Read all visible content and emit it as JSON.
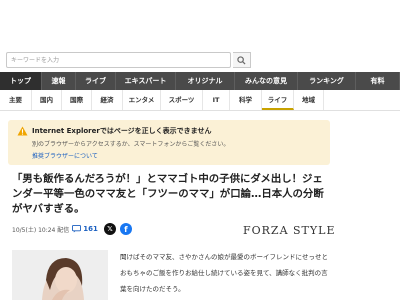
{
  "search": {
    "placeholder": "キーワードを入力"
  },
  "nav_primary": [
    {
      "label": "トップ",
      "active": true
    },
    {
      "label": "速報",
      "active": false
    },
    {
      "label": "ライブ",
      "active": false
    },
    {
      "label": "エキスパート",
      "active": false
    },
    {
      "label": "オリジナル",
      "active": false
    },
    {
      "label": "みんなの意見",
      "active": false
    },
    {
      "label": "ランキング",
      "active": false
    },
    {
      "label": "有料",
      "active": false
    }
  ],
  "nav_secondary": [
    {
      "label": "主要",
      "active": false
    },
    {
      "label": "国内",
      "active": false
    },
    {
      "label": "国際",
      "active": false
    },
    {
      "label": "経済",
      "active": false
    },
    {
      "label": "エンタメ",
      "active": false
    },
    {
      "label": "スポーツ",
      "active": false
    },
    {
      "label": "IT",
      "active": false
    },
    {
      "label": "科学",
      "active": false
    },
    {
      "label": "ライフ",
      "active": true
    },
    {
      "label": "地域",
      "active": false
    }
  ],
  "notice": {
    "title": "Internet Explorerではページを正しく表示できません",
    "body": "別のブラウザーからアクセスするか、スマートフォンからご覧ください。",
    "link": "推奨ブラウザーについて"
  },
  "article": {
    "headline": "「男も飯作るんだろうが！」とママゴト中の子供にダメ出し！ジェンダー平等一色のママ友と「フツーのママ」が口論…日本人の分断がヤバすぎる。",
    "date": "10/5(土) 10:24 配信",
    "comment_count": "161",
    "source": "FORZA STYLE",
    "body": "聞けばそのママ友、さやかさんの娘が最愛のボーイフレンドにせっせとおもちゃのご飯を作りお給仕し続けている姿を見て、講師なく批判の言葉を向けたのだそう。"
  },
  "colors": {
    "nav_bg": "#4a4a4a",
    "nav_active_bg": "#2f2f2f",
    "notice_bg": "#fbf1d6",
    "link": "#1a5fc0",
    "active_underline": "#c8a200"
  }
}
